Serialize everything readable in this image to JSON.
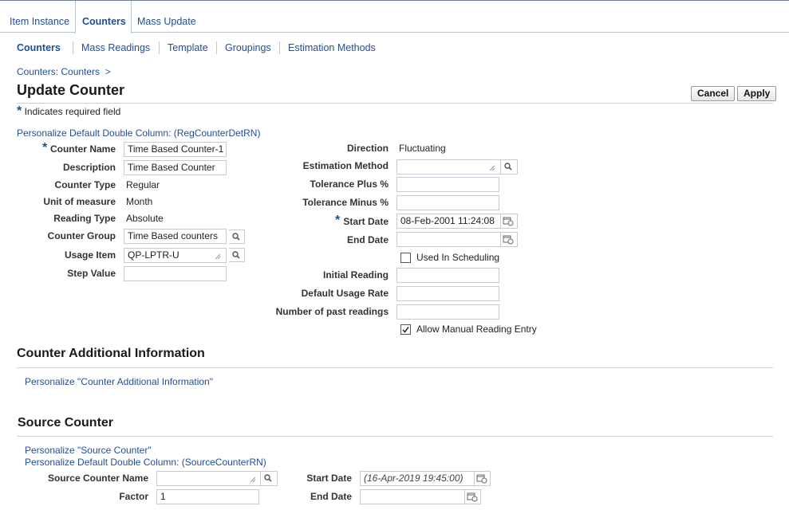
{
  "tabs": [
    {
      "label": "Item Instance"
    },
    {
      "label": "Counters"
    },
    {
      "label": "Mass Update"
    }
  ],
  "subnav": [
    {
      "label": "Counters"
    },
    {
      "label": "Mass Readings"
    },
    {
      "label": "Template"
    },
    {
      "label": "Groupings"
    },
    {
      "label": "Estimation Methods"
    }
  ],
  "breadcrumb": "Counters: Counters  >",
  "page_title": "Update Counter",
  "buttons": {
    "cancel": "Cancel",
    "apply": "Apply"
  },
  "required_note": "Indicates required field",
  "personalize_main": "Personalize Default Double Column: (RegCounterDetRN)",
  "left_form": {
    "counter_name": {
      "label": "Counter Name",
      "value": "Time Based Counter-1"
    },
    "description": {
      "label": "Description",
      "value": "Time Based Counter"
    },
    "counter_type": {
      "label": "Counter Type",
      "value": "Regular"
    },
    "unit_of_measure": {
      "label": "Unit of measure",
      "value": "Month"
    },
    "reading_type": {
      "label": "Reading Type",
      "value": "Absolute"
    },
    "counter_group": {
      "label": "Counter Group",
      "value": "Time Based counters"
    },
    "usage_item": {
      "label": "Usage Item",
      "value": "QP-LPTR-U"
    },
    "step_value": {
      "label": "Step Value",
      "value": ""
    }
  },
  "right_form": {
    "direction": {
      "label": "Direction",
      "value": "Fluctuating"
    },
    "estimation_method": {
      "label": "Estimation Method",
      "value": ""
    },
    "tolerance_plus": {
      "label": "Tolerance Plus %",
      "value": ""
    },
    "tolerance_minus": {
      "label": "Tolerance Minus %",
      "value": ""
    },
    "start_date": {
      "label": "Start Date",
      "value": "08-Feb-2001 11:24:08"
    },
    "end_date": {
      "label": "End Date",
      "value": ""
    },
    "used_in_scheduling": {
      "label": "Used In Scheduling",
      "checked": false
    },
    "initial_reading": {
      "label": "Initial Reading",
      "value": ""
    },
    "default_usage_rate": {
      "label": "Default Usage Rate",
      "value": ""
    },
    "number_past_readings": {
      "label": "Number of past readings",
      "value": ""
    },
    "allow_manual": {
      "label": "Allow Manual Reading Entry",
      "checked": true
    }
  },
  "additional_info": {
    "title": "Counter Additional Information",
    "personalize": "Personalize \"Counter Additional Information\""
  },
  "source_counter": {
    "title": "Source Counter",
    "personalize_1": "Personalize \"Source Counter\"",
    "personalize_2": "Personalize Default Double Column: (SourceCounterRN)",
    "name": {
      "label": "Source Counter Name",
      "value": ""
    },
    "factor": {
      "label": "Factor",
      "value": "1"
    },
    "start_date": {
      "label": "Start Date",
      "value": "(16-Apr-2019 19:45:00)"
    },
    "end_date": {
      "label": "End Date",
      "value": ""
    }
  },
  "icons": {
    "search": "magnifier-icon",
    "calendar": "calendar-icon",
    "resize": "resize-grip-icon"
  }
}
